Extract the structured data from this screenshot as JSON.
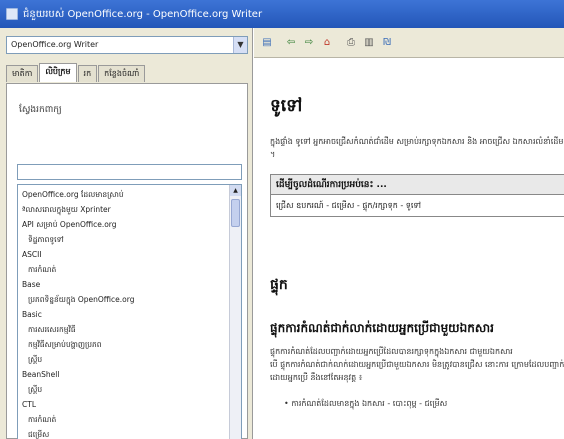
{
  "window": {
    "title": "ជំនួយរបស់ OpenOffice.org - OpenOffice.org Writer"
  },
  "module_select": {
    "value": "OpenOffice.org Writer"
  },
  "tabs": [
    {
      "label": "មាតិកា"
    },
    {
      "label": "លិបិក្រម"
    },
    {
      "label": "រក"
    },
    {
      "label": "កន្លែងចំណាំ"
    }
  ],
  "index": {
    "search_label": "ស្វែងរកពាក្យ",
    "search_value": "",
    "entries": [
      {
        "text": "OpenOffice.org ដែលមានស្រាប់",
        "level": 0
      },
      {
        "text": "ªលាសរោលក្នុងមួយ Xprinter",
        "level": 0
      },
      {
        "text": "API សម្រាប់ OpenOffice.org",
        "level": 0
      },
      {
        "text": "ទិដ្ឋភាពទូទៅ",
        "level": 1
      },
      {
        "text": "ASCII",
        "level": 0
      },
      {
        "text": "ការកំណត់",
        "level": 1
      },
      {
        "text": "Base",
        "level": 0
      },
      {
        "text": "ប្រភពទិន្នន័យក្នុង OpenOffice.org",
        "level": 1
      },
      {
        "text": "Basic",
        "level": 0
      },
      {
        "text": "ការសរសេរកម្មវិធី",
        "level": 1
      },
      {
        "text": "កម្មវិធីសម្រាប់បង្ហាញប្រភព",
        "level": 1
      },
      {
        "text": "ស្គ្រីប",
        "level": 1
      },
      {
        "text": "BeanShell",
        "level": 0
      },
      {
        "text": "ស្គ្រីប",
        "level": 1
      },
      {
        "text": "CTL",
        "level": 0
      },
      {
        "text": "ការកំណត់",
        "level": 1
      },
      {
        "text": "ជម្រើស",
        "level": 1
      }
    ]
  },
  "toolbar": {
    "buttons": [
      {
        "icon": "panel-toggle-icon",
        "glyph": "▤"
      },
      {
        "icon": "back-icon",
        "glyph": "⇦"
      },
      {
        "icon": "forward-icon",
        "glyph": "⇨"
      },
      {
        "icon": "home-icon",
        "glyph": "⌂"
      },
      {
        "icon": "print-icon",
        "glyph": "⎙"
      },
      {
        "icon": "bookmark-icon",
        "glyph": "▥"
      },
      {
        "icon": "find-icon",
        "glyph": "₪"
      }
    ]
  },
  "content": {
    "title": "ទូទៅ",
    "intro": "ក្នុងផ្ទាំង ទូទៅ អ្នកអាចជ្រើសកំណត់ជាំដើម សម្រាប់រក្សាទុកឯកសារ និង អាចជ្រើស ឯកសារលំនាំដើម ។",
    "howto_header": "ដើម្បីចូលដំណើរការប្រអប់នេះ ...",
    "howto_path": "ជ្រើស ឧបករណ៍ - ជម្រើស - ផ្ទុក/រក្សាទុក - ទូទៅ",
    "section_title": "ផ្ទុក",
    "subsection_title": "ផ្ទុកការកំណត់ជាក់លាក់ដោយអ្នកប្រើជាមួយឯកសារ",
    "para1": "ផ្ទុកការកំណត់ដែលបញ្ជាក់ដោយអ្នកប្រើដែលបានរក្សាទុកក្នុងឯកសារ ជាមួយឯកសារ",
    "para2": "បើ ផ្ទុកការកំណត់ជាក់លាក់ដោយអ្នកប្រើជាមួយឯកសារ មិនត្រូវបានជ្រើស នោះការ ក្រោមដែលបញ្ជាក់ដោយអ្នកប្រើ នឹងនៅតែអនុវត្ត ៖",
    "bullet1": "ការកំណត់ដែលមានក្នុង ឯកសារ - បោះពុម្ព - ជម្រើស"
  }
}
